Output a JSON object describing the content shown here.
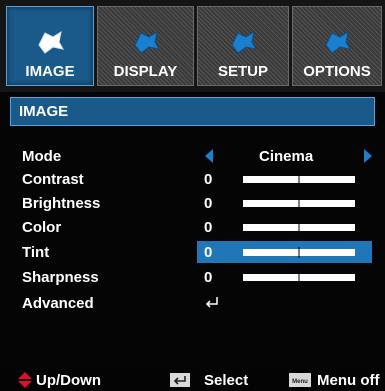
{
  "tabs": [
    {
      "label": "IMAGE",
      "icon": "image-gear-icon",
      "active": true
    },
    {
      "label": "DISPLAY",
      "icon": "display-gear-icon",
      "active": false
    },
    {
      "label": "SETUP",
      "icon": "setup-gear-icon",
      "active": false
    },
    {
      "label": "OPTIONS",
      "icon": "options-gear-icon",
      "active": false
    }
  ],
  "section": {
    "title": "IMAGE"
  },
  "rows": [
    {
      "label": "Mode",
      "value": "Cinema"
    },
    {
      "label": "Contrast",
      "value": "0",
      "level": 0.5
    },
    {
      "label": "Brightness",
      "value": "0",
      "level": 0.5
    },
    {
      "label": "Color",
      "value": "0",
      "level": 0.5
    },
    {
      "label": "Tint",
      "value": "0",
      "level": 0.5,
      "highlighted": true
    },
    {
      "label": "Sharpness",
      "value": "0",
      "level": 0.5
    },
    {
      "label": "Advanced",
      "value_icon": "enter-icon"
    }
  ],
  "footer": {
    "updown_label": "Up/Down",
    "select_label": "Select",
    "menu_key": "Menu",
    "menu_label": "Menu off"
  },
  "colors": {
    "accent": "#1a5a8a",
    "highlight": "#2176b8",
    "arrow": "#1b7fd0",
    "updown_icon": "#e0102a"
  }
}
